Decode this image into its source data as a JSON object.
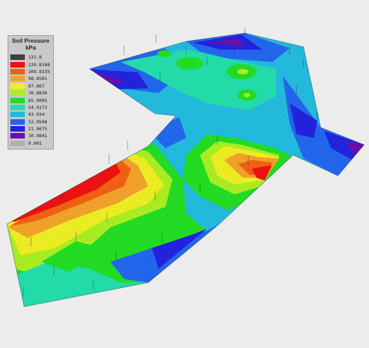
{
  "legend": {
    "title": "Soil Pressure",
    "unit": "kPa",
    "entries": [
      {
        "label": "131.8",
        "color": "#404040"
      },
      {
        "label": "120.8168",
        "color": "#ee1111"
      },
      {
        "label": "109.8335",
        "color": "#f26012"
      },
      {
        "label": "98.8501",
        "color": "#f2a22a"
      },
      {
        "label": "87.867",
        "color": "#eeee22"
      },
      {
        "label": "76.8838",
        "color": "#aaee22"
      },
      {
        "label": "65.9005",
        "color": "#22dd22"
      },
      {
        "label": "54.9173",
        "color": "#22ddaa"
      },
      {
        "label": "43.934",
        "color": "#22bbdd"
      },
      {
        "label": "32.9508",
        "color": "#2266ee"
      },
      {
        "label": "21.9675",
        "color": "#2222dd"
      },
      {
        "label": "10.9841",
        "color": "#6611aa"
      },
      {
        "label": "0.001",
        "color": "#b0b0b0"
      }
    ]
  },
  "plot": {
    "description_icon": "soil-pressure-contour-mesh",
    "colors": {
      "background": "#ececec",
      "red": "#ee1111",
      "orange": "#f28a1e",
      "yellow": "#eeee22",
      "lightgreen": "#aaee22",
      "green": "#22dd22",
      "teal": "#22ddaa",
      "cyan": "#22bbdd",
      "blue": "#2266ee",
      "darkblue": "#2222dd",
      "purple": "#6611aa"
    }
  }
}
